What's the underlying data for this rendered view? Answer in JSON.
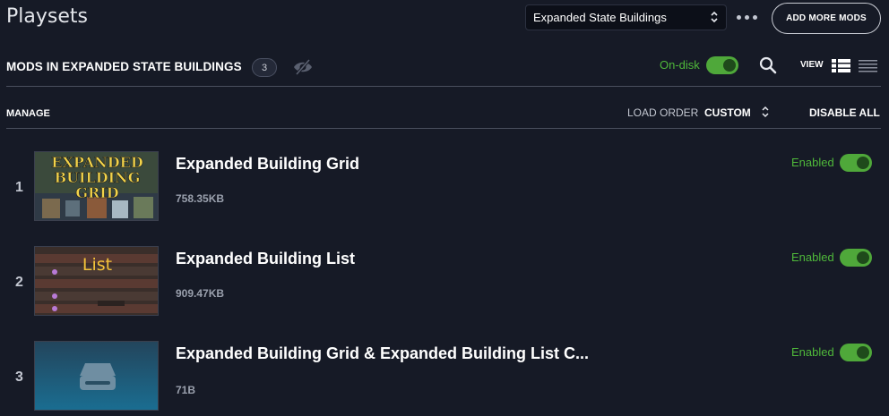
{
  "header": {
    "title": "Playsets",
    "playset_select": "Expanded State Buildings",
    "add_more_mods": "ADD MORE MODS"
  },
  "mods_bar": {
    "heading": "MODS IN EXPANDED STATE BUILDINGS",
    "count": "3",
    "ondisk_label": "On-disk",
    "view_label": "VIEW"
  },
  "manage_bar": {
    "manage": "MANAGE",
    "load_order": "LOAD ORDER",
    "sort_value": "CUSTOM",
    "disable_all": "DISABLE ALL"
  },
  "mods": [
    {
      "index": "1",
      "name": "Expanded Building Grid",
      "size": "758.35KB",
      "status": "Enabled",
      "thumb_text": [
        "EXPANDED",
        "BUILDING",
        "GRID"
      ]
    },
    {
      "index": "2",
      "name": "Expanded Building List",
      "size": "909.47KB",
      "status": "Enabled",
      "thumb_text": [
        "List"
      ]
    },
    {
      "index": "3",
      "name": "Expanded Building Grid & Expanded Building List C...",
      "size": "71B",
      "status": "Enabled",
      "thumb_icon": "drive-icon"
    }
  ],
  "colors": {
    "background": "#161a26",
    "accent_green": "#4fb83a",
    "divider": "#4a4f5e"
  }
}
